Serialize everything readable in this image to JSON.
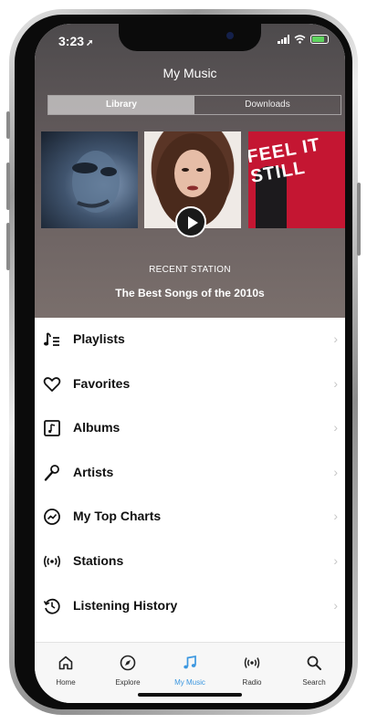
{
  "status_bar": {
    "time": "3:23",
    "location_glyph": "➚"
  },
  "header": {
    "title": "My Music"
  },
  "segmented": {
    "library": "Library",
    "downloads": "Downloads",
    "active": "Library"
  },
  "station": {
    "label": "RECENT STATION",
    "name": "The Best Songs of the 2010s"
  },
  "album_art": {
    "art3_text": "FEEL IT STILL"
  },
  "menu": [
    {
      "label": "Playlists",
      "icon": "playlist-icon"
    },
    {
      "label": "Favorites",
      "icon": "heart-icon"
    },
    {
      "label": "Albums",
      "icon": "album-icon"
    },
    {
      "label": "Artists",
      "icon": "microphone-icon"
    },
    {
      "label": "My Top Charts",
      "icon": "chart-icon"
    },
    {
      "label": "Stations",
      "icon": "radio-waves-icon"
    },
    {
      "label": "Listening History",
      "icon": "history-icon"
    }
  ],
  "tabs": [
    {
      "label": "Home",
      "icon": "home-icon"
    },
    {
      "label": "Explore",
      "icon": "compass-icon"
    },
    {
      "label": "My Music",
      "icon": "music-note-icon"
    },
    {
      "label": "Radio",
      "icon": "radio-icon"
    },
    {
      "label": "Search",
      "icon": "search-icon"
    }
  ],
  "colors": {
    "accent": "#3b97e0",
    "art_red": "#c41632"
  }
}
